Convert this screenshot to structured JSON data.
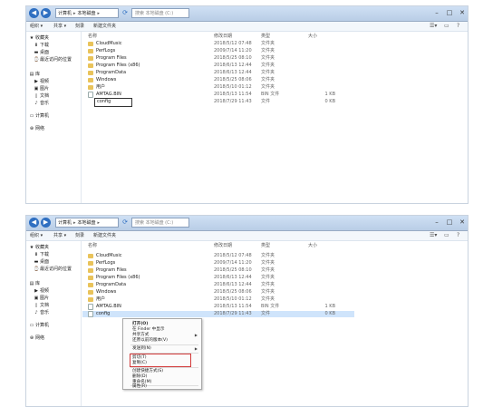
{
  "top": {
    "address": [
      "计算机",
      "本地磁盘",
      ""
    ],
    "search_placeholder": "搜索 本地磁盘 (C:)",
    "toolbar": {
      "organize": "组织 ▾",
      "share": "共享 ▾",
      "burn": "刻录",
      "newfolder": "新建文件夹"
    },
    "columns": {
      "name": "名称",
      "date": "修改日期",
      "type": "类型",
      "size": "大小"
    },
    "sidebar": [
      {
        "icon": "star-icon",
        "label": "收藏夹"
      },
      {
        "icon": "download-icon",
        "label": "下载"
      },
      {
        "icon": "desktop-icon",
        "label": "桌面"
      },
      {
        "icon": "recent-icon",
        "label": "最近访问的位置"
      },
      {
        "icon": "library-icon",
        "label": "库"
      },
      {
        "icon": "video-icon",
        "label": "视频"
      },
      {
        "icon": "image-icon",
        "label": "图片"
      },
      {
        "icon": "document-icon",
        "label": "文档"
      },
      {
        "icon": "music-icon",
        "label": "音乐"
      },
      {
        "icon": "computer-icon",
        "label": "计算机"
      },
      {
        "icon": "network-icon",
        "label": "网络"
      }
    ],
    "files": [
      {
        "name": "CloudMusic",
        "date": "2018/5/12 07:48",
        "type": "文件夹",
        "size": ""
      },
      {
        "name": "PerfLogs",
        "date": "2009/7/14 11:20",
        "type": "文件夹",
        "size": ""
      },
      {
        "name": "Program Files",
        "date": "2018/5/25 08:10",
        "type": "文件夹",
        "size": ""
      },
      {
        "name": "Program Files (x86)",
        "date": "2018/6/13 12:44",
        "type": "文件夹",
        "size": ""
      },
      {
        "name": "ProgramData",
        "date": "2018/6/13 12:44",
        "type": "文件夹",
        "size": ""
      },
      {
        "name": "Windows",
        "date": "2018/5/25 08:06",
        "type": "文件夹",
        "size": ""
      },
      {
        "name": "用户",
        "date": "2018/5/10 01:12",
        "type": "文件夹",
        "size": ""
      },
      {
        "name": "AMTAG.BIN",
        "date": "2018/5/13 11:54",
        "type": "BIN 文件",
        "size": "1 KB"
      },
      {
        "name": "config",
        "date": "2018/7/29 11:43",
        "type": "文件",
        "size": "0 KB"
      }
    ]
  },
  "bottom": {
    "address": [
      "计算机",
      "本地磁盘",
      ""
    ],
    "search_placeholder": "搜索 本地磁盘 (C:)",
    "toolbar": {
      "organize": "组织 ▾",
      "share": "共享 ▾",
      "burn": "刻录",
      "newfolder": "新建文件夹"
    },
    "columns": {
      "name": "名称",
      "date": "修改日期",
      "type": "类型",
      "size": "大小"
    },
    "files": [
      {
        "name": "CloudMusic",
        "date": "2018/5/12 07:48",
        "type": "文件夹",
        "size": ""
      },
      {
        "name": "PerfLogs",
        "date": "2009/7/14 11:20",
        "type": "文件夹",
        "size": ""
      },
      {
        "name": "Program Files",
        "date": "2018/5/25 08:10",
        "type": "文件夹",
        "size": ""
      },
      {
        "name": "Program Files (x86)",
        "date": "2018/6/13 12:44",
        "type": "文件夹",
        "size": ""
      },
      {
        "name": "ProgramData",
        "date": "2018/6/13 12:44",
        "type": "文件夹",
        "size": ""
      },
      {
        "name": "Windows",
        "date": "2018/5/25 08:06",
        "type": "文件夹",
        "size": ""
      },
      {
        "name": "用户",
        "date": "2018/5/10 01:12",
        "type": "文件夹",
        "size": ""
      },
      {
        "name": "AMTAG.BIN",
        "date": "2018/5/13 11:54",
        "type": "BIN 文件",
        "size": "1 KB"
      },
      {
        "name": "config",
        "date": "2018/7/29 11:43",
        "type": "文件",
        "size": "0 KB"
      }
    ],
    "context_menu": [
      {
        "label": "打开(O)",
        "bold": true
      },
      {
        "label": "在 Finder 中显示"
      },
      {
        "label": "共享方式",
        "submenu": true
      },
      {
        "label": "还原以前的版本(V)"
      },
      {
        "label": "发送到(N)",
        "submenu": true
      },
      {
        "label": "剪切(T)"
      },
      {
        "label": "复制(C)"
      },
      {
        "label": "创建快捷方式(S)"
      },
      {
        "label": "删除(D)"
      },
      {
        "label": "重命名(M)"
      },
      {
        "label": "属性(R)"
      }
    ]
  },
  "colors": {
    "selection": "#cfe4fb",
    "highlight_border": "#d23a3a",
    "folder": "#e9c35b"
  }
}
